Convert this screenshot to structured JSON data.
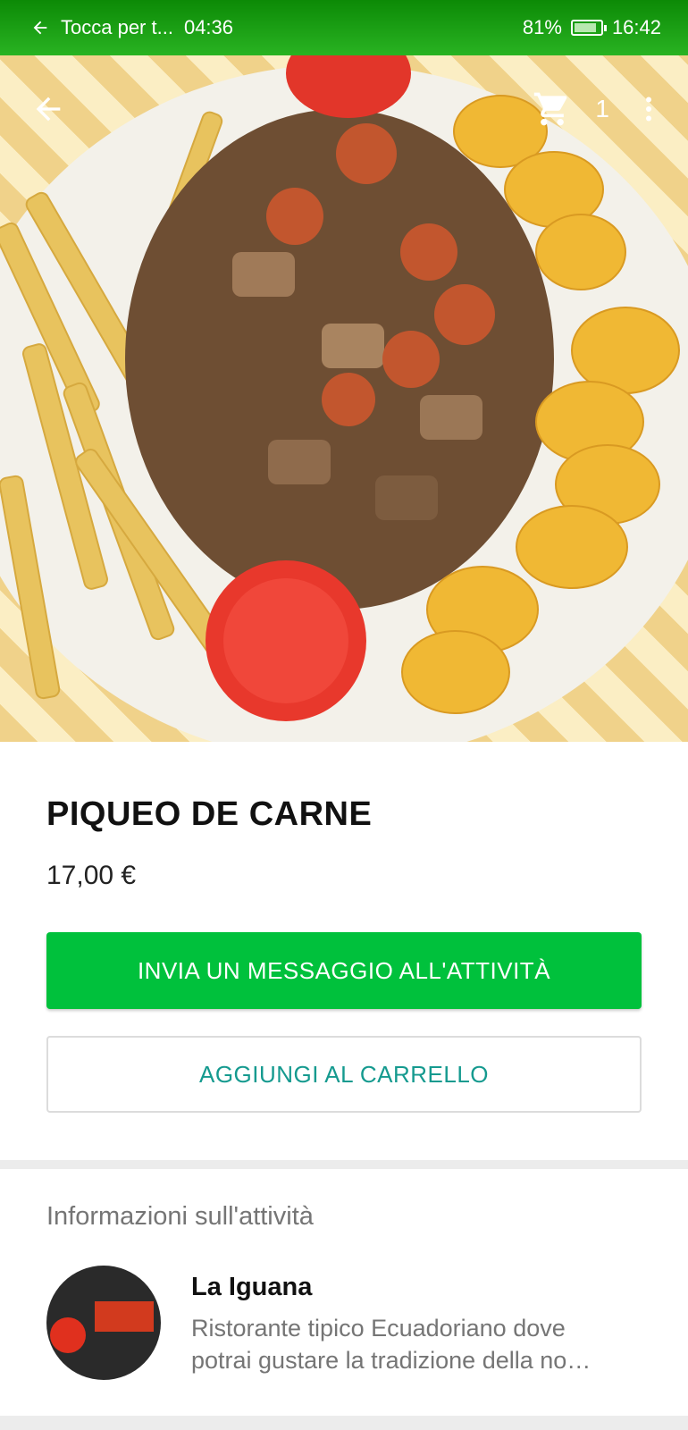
{
  "status_bar": {
    "notification_text": "Tocca per t...",
    "call_timer": "04:36",
    "battery_level": "81%",
    "time": "16:42"
  },
  "hero": {
    "image_label": "Piatto: carne, salsiccia, patatine, platano fritto"
  },
  "top_bar": {
    "cart_count": "1"
  },
  "product": {
    "title": "PIQUEO DE CARNE",
    "price": "17,00 €"
  },
  "actions": {
    "message_label": "INVIA UN MESSAGGIO ALL'ATTIVITÀ",
    "add_to_cart_label": "AGGIUNGI AL CARRELLO"
  },
  "business_info": {
    "heading": "Informazioni sull'attività",
    "name": "La Iguana",
    "description": "Ristorante tipico Ecuadoriano dove potrai gustare la tradizione della no…"
  },
  "colors": {
    "status_green": "#29b322",
    "primary_button": "#00c13c",
    "secondary_text": "#159a8f"
  }
}
